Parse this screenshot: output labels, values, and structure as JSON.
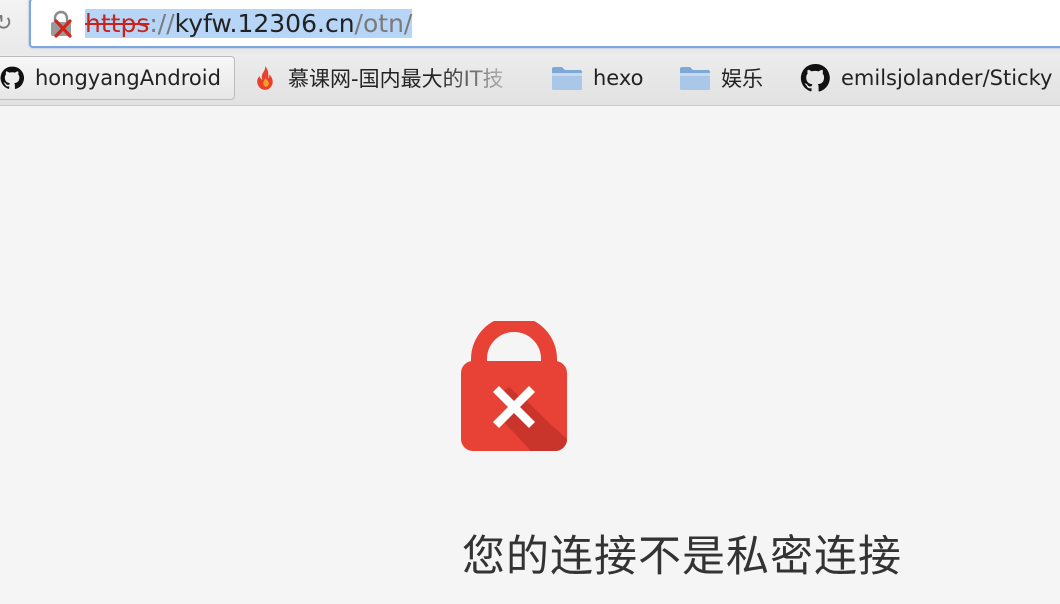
{
  "address_bar": {
    "url_scheme": "https",
    "url_separator": "://",
    "url_host": "kyfw.12306.cn",
    "url_path": "/otn/",
    "security_icon": "broken-lock-icon"
  },
  "bookmarks": [
    {
      "label": "hongyangAndroid",
      "icon": "github-icon"
    },
    {
      "label": "慕课网-国内最大的IT技",
      "icon": "flame-icon"
    },
    {
      "label": "hexo",
      "icon": "folder-icon"
    },
    {
      "label": "娱乐",
      "icon": "folder-icon"
    },
    {
      "label": "emilsjolander/Sticky",
      "icon": "github-icon"
    }
  ],
  "interstitial": {
    "icon": "red-lock-error-icon",
    "heading": "您的连接不是私密连接"
  },
  "colors": {
    "error_red": "#e84135",
    "scheme_red": "#c8241b",
    "page_bg": "#f5f5f5",
    "selection": "#b6d5f7"
  }
}
